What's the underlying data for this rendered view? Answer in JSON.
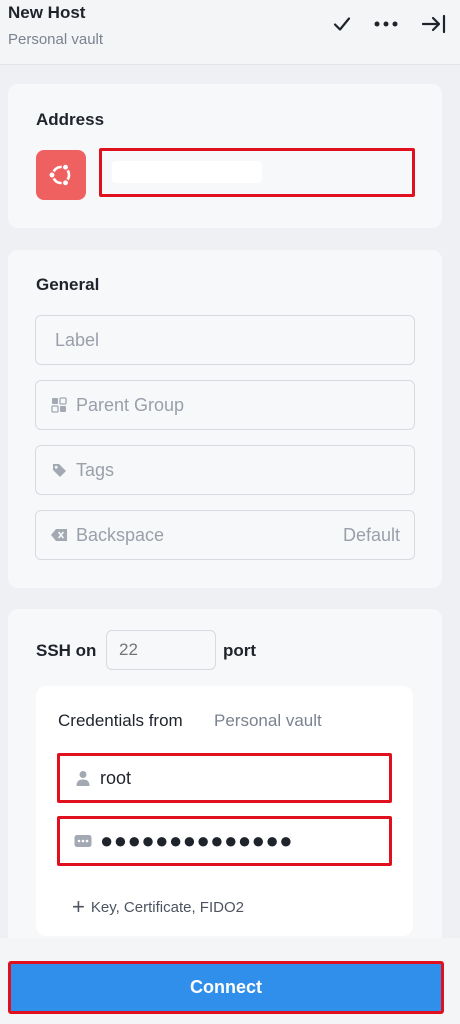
{
  "header": {
    "title": "New Host",
    "subtitle": "Personal vault",
    "icons": [
      "check-icon",
      "more-icon",
      "collapse-panel-icon"
    ]
  },
  "address": {
    "section_title": "Address",
    "os_icon": "ubuntu-icon",
    "value": ""
  },
  "general": {
    "section_title": "General",
    "label_placeholder": "Label",
    "parent_group_placeholder": "Parent Group",
    "tags_placeholder": "Tags",
    "backspace_label": "Backspace",
    "backspace_value": "Default"
  },
  "ssh": {
    "label": "SSH on",
    "port_placeholder": "22",
    "port_suffix": "port",
    "credentials_label": "Credentials from",
    "credentials_source": "Personal vault",
    "username": "root",
    "password_mask": "●●●●●●●●●●●●●●",
    "add_key_label": "Key, Certificate, FIDO2"
  },
  "footer": {
    "connect_label": "Connect"
  },
  "colors": {
    "accent": "#2f8fea",
    "highlight": "#e0101e",
    "os_badge": "#ef6160"
  }
}
